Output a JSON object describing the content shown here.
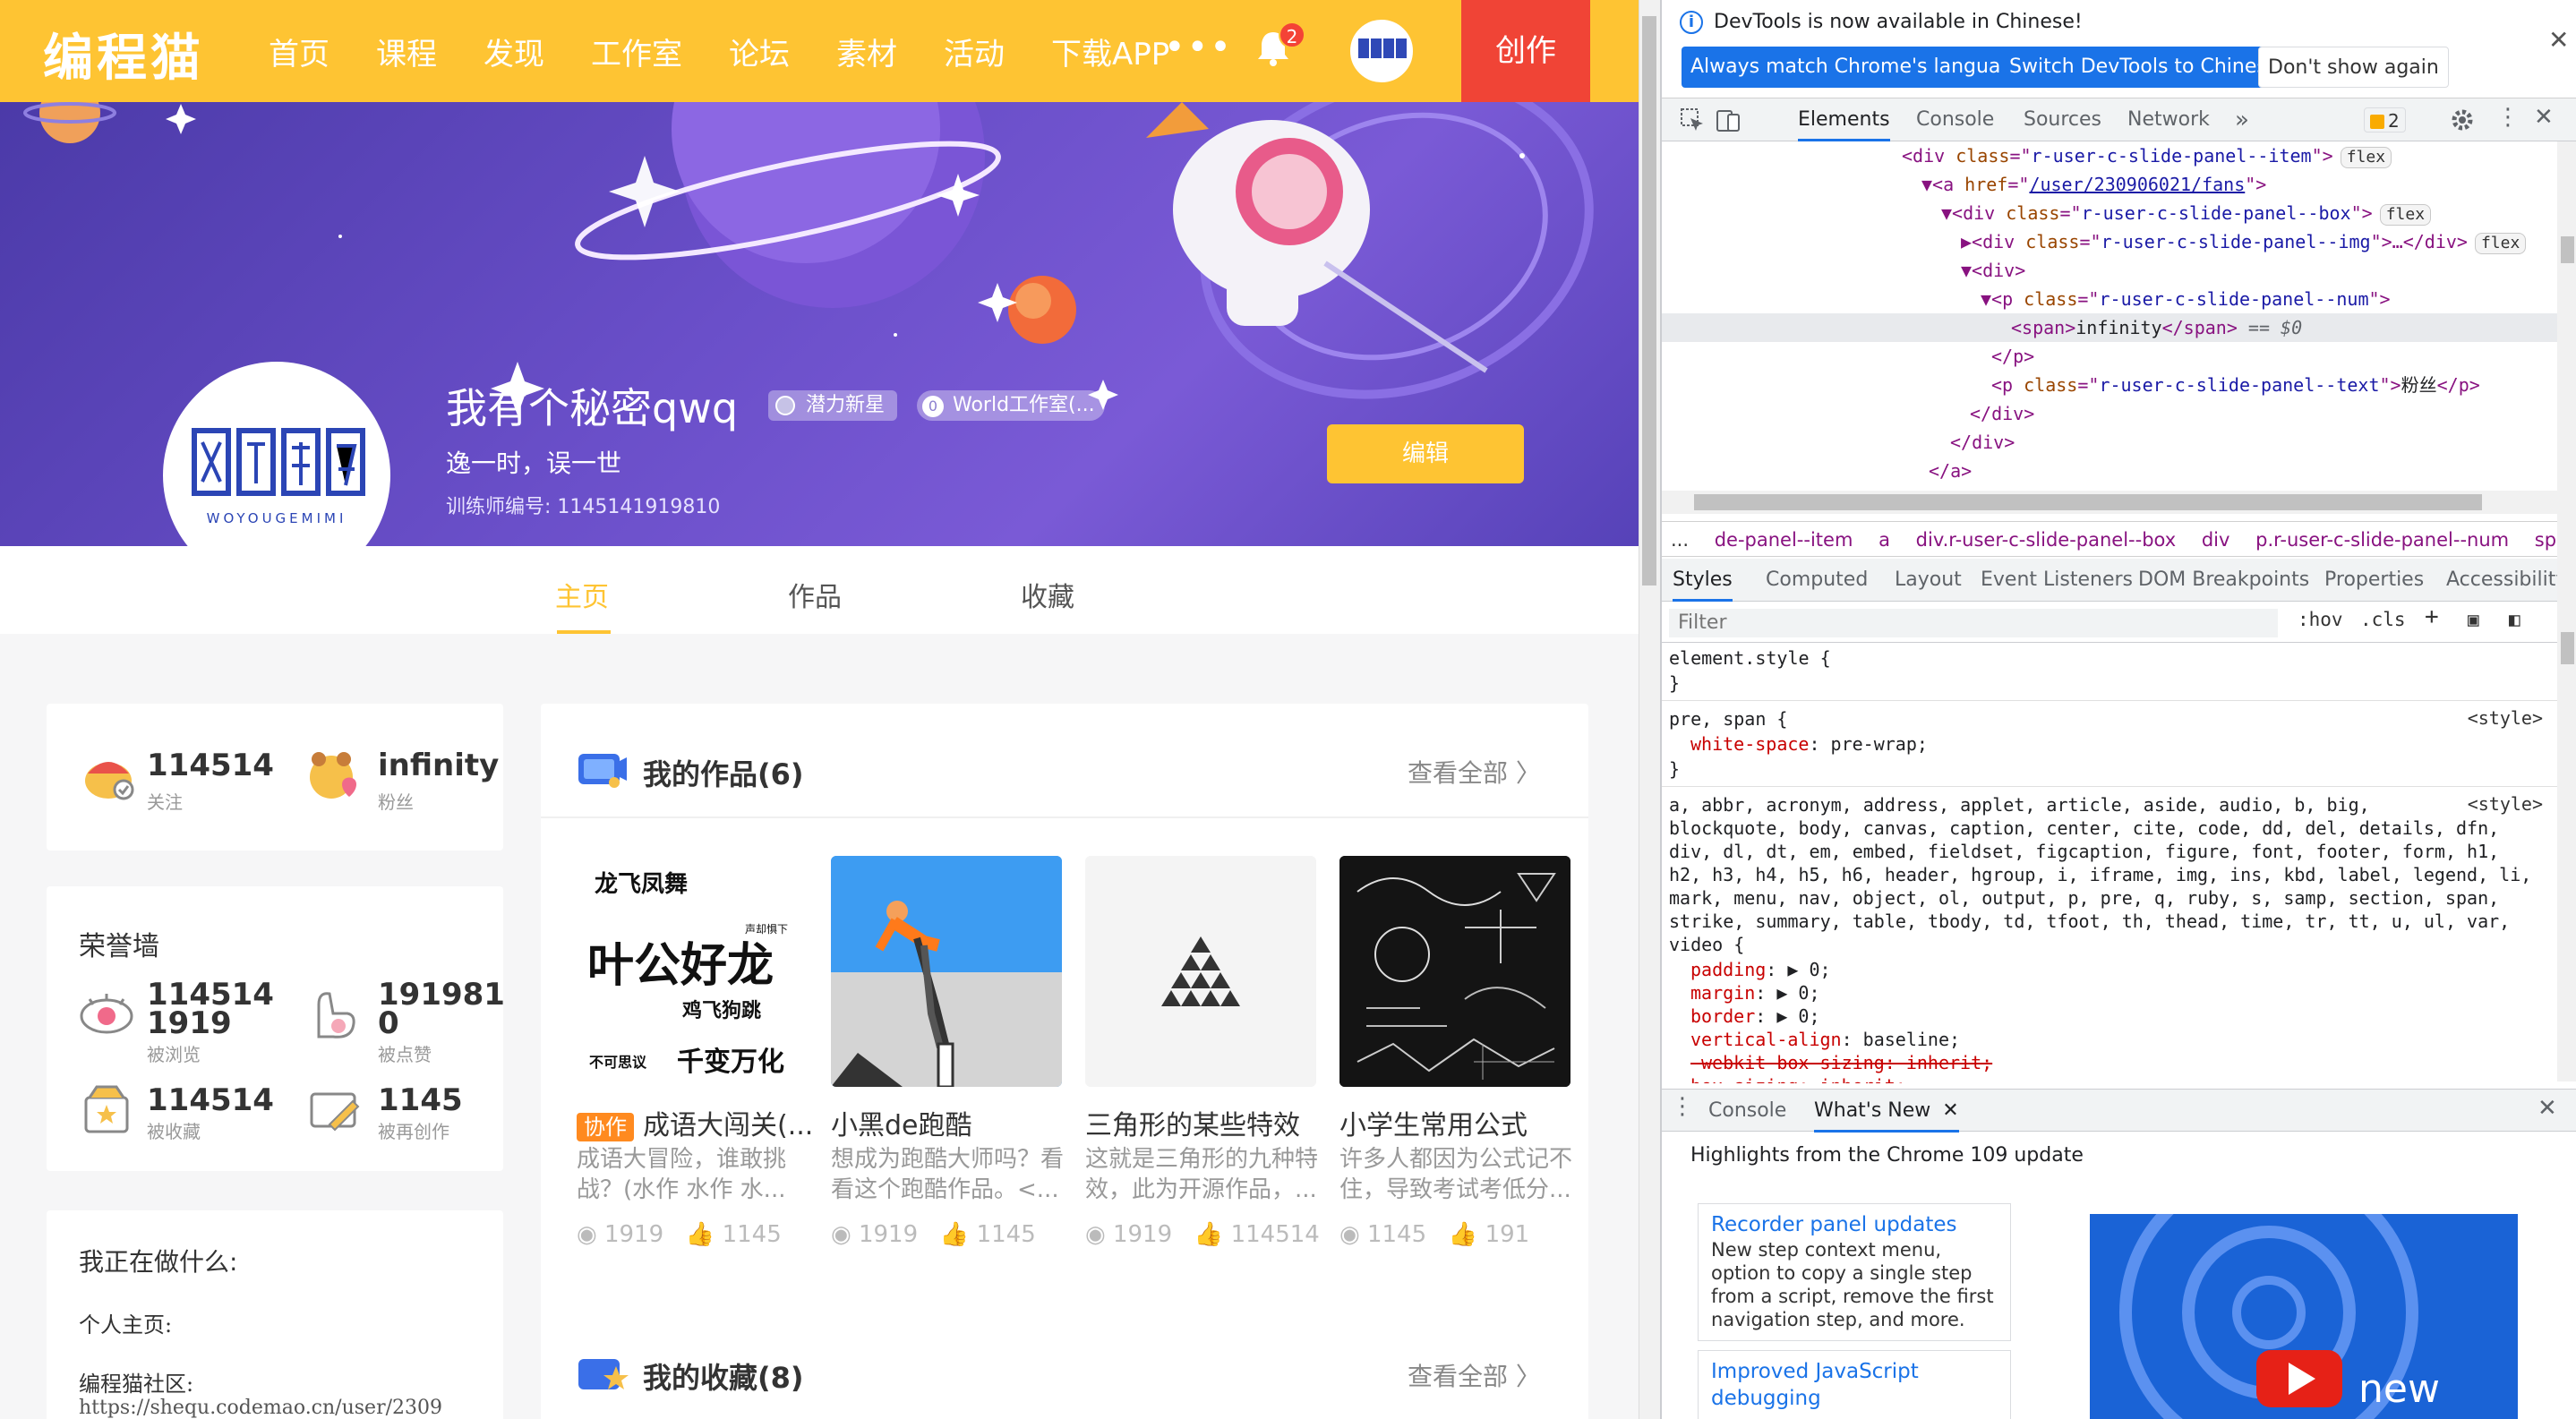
{
  "site": {
    "logo": "编程猫",
    "nav": [
      "首页",
      "课程",
      "发现",
      "工作室",
      "论坛",
      "素材",
      "活动",
      "下载APP"
    ],
    "nav_more": "•••",
    "notification_count": "2",
    "create_label": "创作",
    "avatar_lettering": "WOYOUGEMIMI"
  },
  "profile": {
    "name": "我有个秘密qwq",
    "badge_level": "潜力新星",
    "badge_studio_icon": "0",
    "badge_studio": "World工作室(...",
    "motto": "逸一时，误一世",
    "trainer_id": "训练师编号: 1145141919810",
    "edit_label": "编辑",
    "tabs": [
      "主页",
      "作品",
      "收藏"
    ]
  },
  "follow": {
    "following_num": "114514",
    "following_label": "关注",
    "fans_num": "infinity",
    "fans_label": "粉丝"
  },
  "honor": {
    "title": "荣誉墙",
    "views_num_1": "114514",
    "views_num_2": "1919",
    "views_label": "被浏览",
    "likes_num_1": "191981",
    "likes_num_2": "0",
    "likes_label": "被点赞",
    "collects_num": "114514",
    "collects_label": "被收藏",
    "recreate_num": "1145",
    "recreate_label": "被再创作"
  },
  "doing": {
    "title": "我正在做什么:",
    "line1": "个人主页:",
    "line2": "编程猫社区:",
    "line3": "https://shequ.codemao.cn/user/2309"
  },
  "works": {
    "title": "我的作品(6)",
    "view_all": "查看全部 〉",
    "items": [
      {
        "collab": "协作",
        "title": "成语大闯关(...",
        "desc": "成语大冒险，谁敢挑战？(水作 水作 水...",
        "views": "1919",
        "likes": "1145"
      },
      {
        "collab": "",
        "title": "小黑de跑酷",
        "desc": "想成为跑酷大师吗？看看这个跑酷作品。<...",
        "views": "1919",
        "likes": "1145"
      },
      {
        "collab": "",
        "title": "三角形的某些特效",
        "desc": "这就是三角形的九种特效，此为开源作品，...",
        "views": "1919",
        "likes": "114514"
      },
      {
        "collab": "",
        "title": "小学生常用公式",
        "desc": "许多人都因为公式记不住，导致考试考低分...",
        "views": "1145",
        "likes": "191"
      }
    ],
    "thumb1_text": {
      "a": "龙飞凤舞",
      "b": "叶公好龙",
      "c": "声却惧下",
      "d": "鸡飞狗跳",
      "e": "不可思议",
      "f": "千变万化"
    }
  },
  "collections": {
    "title": "我的收藏(8)",
    "view_all": "查看全部 〉"
  },
  "devtools": {
    "info": "DevTools is now available in Chinese!",
    "btn_match": "Always match Chrome's language",
    "btn_switch": "Switch DevTools to Chinese",
    "btn_dont": "Don't show again",
    "tabs": [
      "Elements",
      "Console",
      "Sources",
      "Network"
    ],
    "tab_more": "»",
    "issues_count": "2",
    "dom": {
      "l1_cls": "r-user-c-slide-panel--item",
      "l2_href": "/user/230906021/fans",
      "l3_cls": "r-user-c-slide-panel--box",
      "l4_cls": "r-user-c-slide-panel--img",
      "l4_rest": ">…</div>",
      "l6_cls": "r-user-c-slide-panel--num",
      "l7_text": "infinity",
      "l7_tail": " == $0",
      "l9_cls": "r-user-c-slide-panel--text",
      "l9_text": "粉丝",
      "flex": "flex"
    },
    "breadcrumb": [
      "...",
      "de-panel--item",
      "a",
      "div.r-user-c-slide-panel--box",
      "div",
      "p.r-user-c-slide-panel--num",
      "span",
      "..."
    ],
    "subtabs": [
      "Styles",
      "Computed",
      "Layout",
      "Event Listeners",
      "DOM Breakpoints",
      "Properties",
      "Accessibility"
    ],
    "filter_placeholder": "Filter",
    "hov": ":hov",
    "cls": ".cls",
    "styles": {
      "element_style": "element.style {",
      "close": "}",
      "rule1_sel": "pre, span {",
      "rule1_src": "<style>",
      "rule1_prop": "white-space",
      "rule1_val": "pre-wrap;",
      "rule2_sel_1": "a, abbr, acronym, address, applet, article, aside, audio, b, big,",
      "rule2_src": "<style>",
      "rule2_sel_2": "blockquote, body, canvas, caption, center, cite, code, dd, del, details, dfn,",
      "rule2_sel_3": "div, dl, dt, em, embed, fieldset, figcaption, figure, font, footer, form, h1,",
      "rule2_sel_4": "h2, h3, h4, h5, h6, header, hgroup, i, iframe, img, ins, kbd, label, legend, li,",
      "rule2_sel_5": "mark, menu, nav, object, ol, output, p, pre, q, ruby, s, samp, section, span,",
      "rule2_sel_6": "strike, summary, table, tbody, td, tfoot, th, thead, time, tr, tt, u, ul, var,",
      "rule2_sel_7": "video {",
      "p_padding": "padding",
      "v_padding": "0;",
      "p_margin": "margin",
      "v_margin": "0;",
      "p_border": "border",
      "v_border": "0;",
      "p_valign": "vertical-align",
      "v_valign": "baseline;",
      "p_webkit": "-webkit-box-sizing: inherit;",
      "p_box": "box-sizing: inherit;"
    },
    "drawer_tabs": [
      "Console",
      "What's New"
    ],
    "whats_new_head": "Highlights from the Chrome 109 update",
    "card1_title": "Recorder panel updates",
    "card1_body": "New step context menu, option to copy a single step from a script, remove the first navigation step, and more.",
    "card2_title": "Improved JavaScript debugging",
    "video_text": "new"
  },
  "colors": {
    "brand": "#fec433",
    "create": "#f04436",
    "devtools_blue": "#1a73e8"
  }
}
